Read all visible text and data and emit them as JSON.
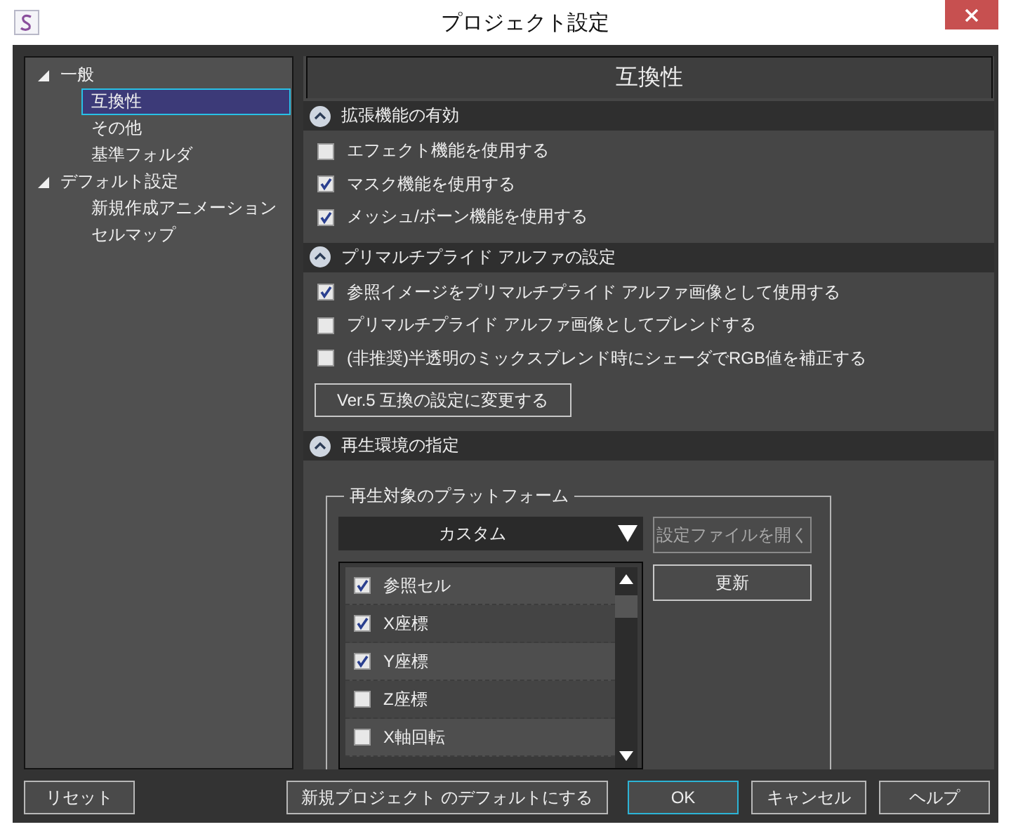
{
  "window": {
    "title": "プロジェクト設定"
  },
  "tree": [
    {
      "label": "一般",
      "expanded": true,
      "selected": false,
      "children": [
        {
          "label": "互換性",
          "selected": true
        },
        {
          "label": "その他",
          "selected": false
        },
        {
          "label": "基準フォルダ",
          "selected": false
        }
      ]
    },
    {
      "label": "デフォルト設定",
      "expanded": true,
      "selected": false,
      "children": [
        {
          "label": "新規作成アニメーション",
          "selected": false
        },
        {
          "label": "セルマップ",
          "selected": false
        }
      ]
    }
  ],
  "panel": {
    "title": "互換性",
    "sections": [
      {
        "kind": "options",
        "title": "拡張機能の有効",
        "expanded": true,
        "options": [
          {
            "label": "エフェクト機能を使用する",
            "checked": false
          },
          {
            "label": "マスク機能を使用する",
            "checked": true
          },
          {
            "label": "メッシュ/ボーン機能を使用する",
            "checked": true
          }
        ]
      },
      {
        "kind": "options",
        "title": "プリマルチプライド アルファの設定",
        "expanded": true,
        "options": [
          {
            "label": "参照イメージをプリマルチプライド アルファ画像として使用する",
            "checked": true
          },
          {
            "label": "プリマルチプライド アルファ画像としてブレンドする",
            "checked": false
          },
          {
            "label": "(非推奨)半透明のミックスブレンド時にシェーダでRGB値を補正する",
            "checked": false
          }
        ],
        "button": "Ver.5 互換の設定に変更する"
      },
      {
        "kind": "platform",
        "title": "再生環境の指定",
        "expanded": true,
        "platform": {
          "legend": "再生対象のプラットフォーム",
          "dropdown": "カスタム",
          "open_button": {
            "label": "設定ファイルを開く",
            "disabled": true
          },
          "update_button": {
            "label": "更新",
            "disabled": false
          },
          "items": [
            {
              "label": "参照セル",
              "checked": true
            },
            {
              "label": "X座標",
              "checked": true
            },
            {
              "label": "Y座標",
              "checked": true
            },
            {
              "label": "Z座標",
              "checked": false
            },
            {
              "label": "X軸回転",
              "checked": false
            }
          ]
        }
      }
    ]
  },
  "footer": {
    "buttons": [
      {
        "label": "リセット",
        "default": false
      },
      {
        "label": "新規プロジェクト のデフォルトにする",
        "default": false
      },
      {
        "label": "OK",
        "default": true
      },
      {
        "label": "キャンセル",
        "default": false
      },
      {
        "label": "ヘルプ",
        "default": false
      }
    ]
  }
}
